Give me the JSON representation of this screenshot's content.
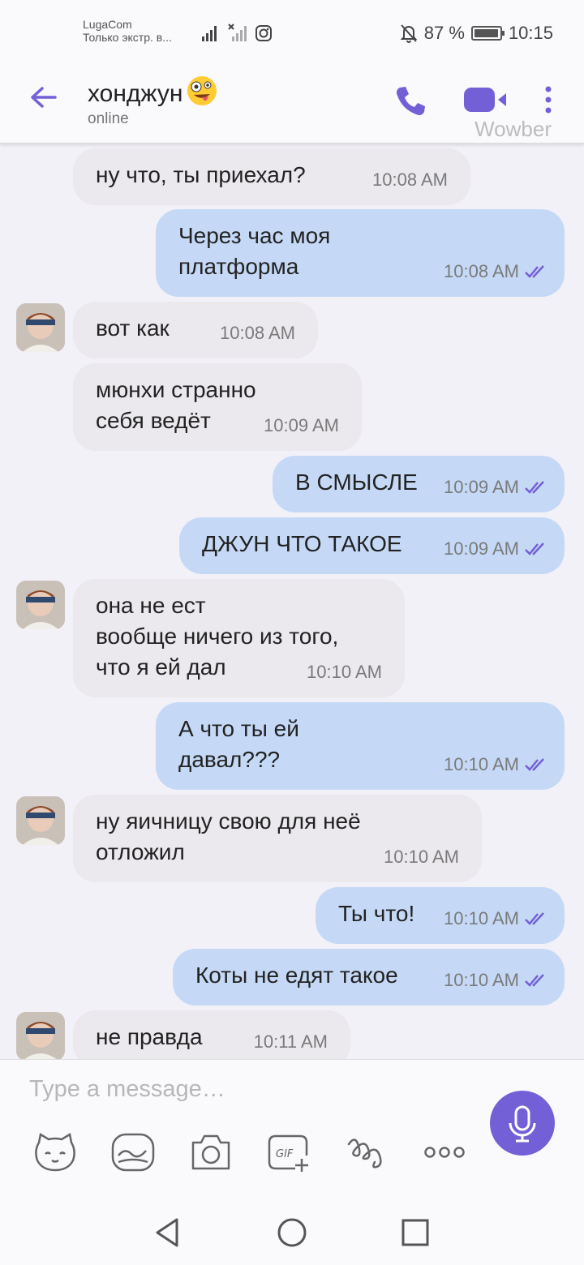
{
  "status_bar": {
    "carrier": "LugaCom",
    "carrier_sub": "Только экстр. в...",
    "battery": "87 %",
    "time": "10:15"
  },
  "header": {
    "contact_name": "хонджун",
    "emoji": "🤪",
    "status": "online",
    "watermark": "Wowber"
  },
  "messages": [
    {
      "dir": "in",
      "text": "ну что, ты приехал?",
      "time": "10:08 AM",
      "avatar": false
    },
    {
      "dir": "out",
      "text": "Через час моя\nплатформа",
      "time": "10:08 AM"
    },
    {
      "dir": "in",
      "text": "вот как",
      "time": "10:08 AM",
      "avatar": true
    },
    {
      "dir": "in",
      "text": "мюнхи странно\nсебя ведёт",
      "time": "10:09 AM",
      "avatar": false
    },
    {
      "dir": "out",
      "text": "В СМЫСЛЕ",
      "time": "10:09 AM"
    },
    {
      "dir": "out",
      "text": "ДЖУН ЧТО ТАКОЕ",
      "time": "10:09 AM"
    },
    {
      "dir": "in",
      "text": "она не ест\nвообще ничего из того,\nчто я ей дал",
      "time": "10:10 AM",
      "avatar": true
    },
    {
      "dir": "out",
      "text": "А что ты ей\nдавал???",
      "time": "10:10 AM"
    },
    {
      "dir": "in",
      "text": "ну яичницу свою для неё\nотложил",
      "time": "10:10 AM",
      "avatar": true
    },
    {
      "dir": "out",
      "text": "Ты что!",
      "time": "10:10 AM"
    },
    {
      "dir": "out",
      "text": "Коты не едят такое",
      "time": "10:10 AM"
    },
    {
      "dir": "in",
      "text": "не правда",
      "time": "10:11 AM",
      "avatar": true
    }
  ],
  "composer": {
    "placeholder": "Type a message…",
    "tools": [
      "sticker-icon",
      "doodle-icon",
      "camera-icon",
      "gif-icon",
      "squiggle-icon",
      "more-dots-icon"
    ]
  },
  "colors": {
    "accent": "#7360d6",
    "incoming_bubble": "#ebe9ee",
    "outgoing_bubble": "#c5d9f6",
    "background": "#f3f1f8"
  }
}
